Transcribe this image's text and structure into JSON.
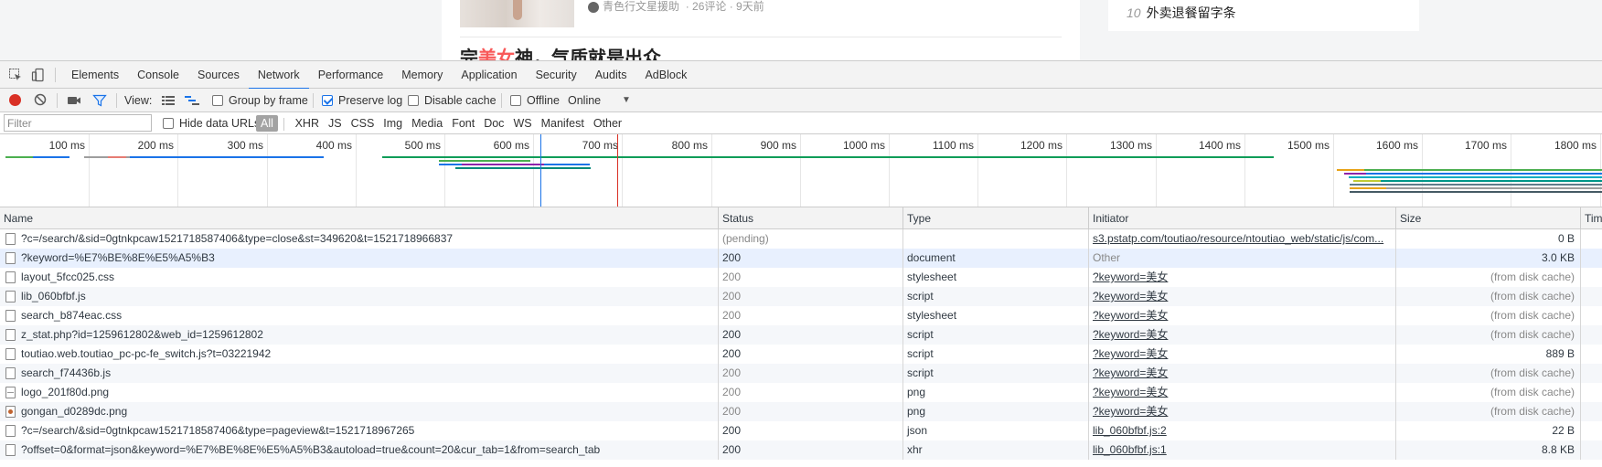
{
  "background_page": {
    "article_meta_author": "青色行文星援助",
    "article_meta_stats": "· 26评论 · 9天前",
    "article_title_pre": "完",
    "article_title_hl": "美女",
    "article_title_post": "神，气质就是出众",
    "side_item_num": "10",
    "side_item_text": "外卖退餐留字条"
  },
  "devtools": {
    "tabs": [
      "Elements",
      "Console",
      "Sources",
      "Network",
      "Performance",
      "Memory",
      "Application",
      "Security",
      "Audits",
      "AdBlock"
    ],
    "active_tab": "Network",
    "toolbar": {
      "view_label": "View:",
      "group_by_frame": "Group by frame",
      "preserve_log": "Preserve log",
      "disable_cache": "Disable cache",
      "offline": "Offline",
      "throttle": "Online",
      "throttle_arrow": "▼"
    },
    "filter": {
      "placeholder": "Filter",
      "hide_data_urls": "Hide data URLs",
      "types": [
        "All",
        "XHR",
        "JS",
        "CSS",
        "Img",
        "Media",
        "Font",
        "Doc",
        "WS",
        "Manifest",
        "Other"
      ],
      "active_type": "All"
    },
    "overview": {
      "ticks": [
        "100 ms",
        "200 ms",
        "300 ms",
        "400 ms",
        "500 ms",
        "600 ms",
        "700 ms",
        "800 ms",
        "900 ms",
        "1000 ms",
        "1100 ms",
        "1200 ms",
        "1300 ms",
        "1400 ms",
        "1500 ms",
        "1600 ms",
        "1700 ms",
        "1800 ms"
      ]
    },
    "columns": {
      "name": "Name",
      "status": "Status",
      "type": "Type",
      "initiator": "Initiator",
      "size": "Size",
      "time": "Time"
    },
    "requests": [
      {
        "name": "?c=/search/&sid=0gtnkpcaw1521718587406&type=close&st=349620&t=1521718966837",
        "status": "(pending)",
        "type": "",
        "initiator": "s3.pstatp.com/toutiao/resource/ntoutiao_web/static/js/com...",
        "size": "0 B",
        "icon": "doc"
      },
      {
        "name": "?keyword=%E7%BE%8E%E5%A5%B3",
        "status": "200",
        "type": "document",
        "initiator": "Other",
        "size": "3.0 KB",
        "icon": "doc"
      },
      {
        "name": "layout_5fcc025.css",
        "status": "200",
        "type": "stylesheet",
        "initiator": "?keyword=美女",
        "size": "(from disk cache)",
        "icon": "doc"
      },
      {
        "name": "lib_060bfbf.js",
        "status": "200",
        "type": "script",
        "initiator": "?keyword=美女",
        "size": "(from disk cache)",
        "icon": "doc"
      },
      {
        "name": "search_b874eac.css",
        "status": "200",
        "type": "stylesheet",
        "initiator": "?keyword=美女",
        "size": "(from disk cache)",
        "icon": "doc"
      },
      {
        "name": "z_stat.php?id=1259612802&web_id=1259612802",
        "status": "200",
        "type": "script",
        "initiator": "?keyword=美女",
        "size": "(from disk cache)",
        "icon": "doc"
      },
      {
        "name": "toutiao.web.toutiao_pc-pc-fe_switch.js?t=03221942",
        "status": "200",
        "type": "script",
        "initiator": "?keyword=美女",
        "size": "889 B",
        "icon": "doc"
      },
      {
        "name": "search_f74436b.js",
        "status": "200",
        "type": "script",
        "initiator": "?keyword=美女",
        "size": "(from disk cache)",
        "icon": "doc"
      },
      {
        "name": "logo_201f80d.png",
        "status": "200",
        "type": "png",
        "initiator": "?keyword=美女",
        "size": "(from disk cache)",
        "icon": "png"
      },
      {
        "name": "gongan_d0289dc.png",
        "status": "200",
        "type": "png",
        "initiator": "?keyword=美女",
        "size": "(from disk cache)",
        "icon": "img"
      },
      {
        "name": "?c=/search/&sid=0gtnkpcaw1521718587406&type=pageview&t=1521718967265",
        "status": "200",
        "type": "json",
        "initiator": "lib_060bfbf.js:2",
        "size": "22 B",
        "icon": "doc"
      },
      {
        "name": "?offset=0&format=json&keyword=%E7%BE%8E%E5%A5%B3&autoload=true&count=20&cur_tab=1&from=search_tab",
        "status": "200",
        "type": "xhr",
        "initiator": "lib_060bfbf.js:1",
        "size": "8.8 KB",
        "icon": "doc"
      }
    ]
  }
}
